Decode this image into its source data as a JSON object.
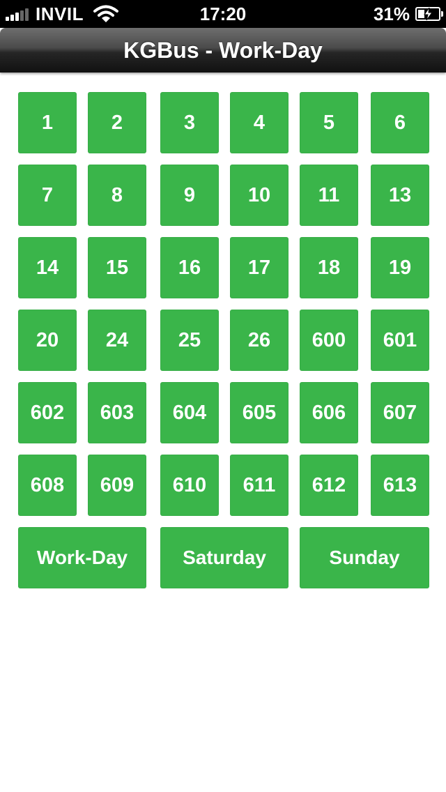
{
  "status_bar": {
    "carrier": "INVIL",
    "time": "17:20",
    "battery": "31%"
  },
  "navbar": {
    "title": "KGBus - Work-Day"
  },
  "routes": [
    "1",
    "2",
    "3",
    "4",
    "5",
    "6",
    "7",
    "8",
    "9",
    "10",
    "11",
    "13",
    "14",
    "15",
    "16",
    "17",
    "18",
    "19",
    "20",
    "24",
    "25",
    "26",
    "600",
    "601",
    "602",
    "603",
    "604",
    "605",
    "606",
    "607",
    "608",
    "609",
    "610",
    "611",
    "612",
    "613"
  ],
  "day_buttons": [
    "Work-Day",
    "Saturday",
    "Sunday"
  ],
  "colors": {
    "button_green": "#3ab54a",
    "status_bar": "#000000",
    "background": "#ffffff"
  },
  "icons": {
    "signal": "signal-bars-icon",
    "wifi": "wifi-icon",
    "battery": "battery-charging-icon"
  }
}
